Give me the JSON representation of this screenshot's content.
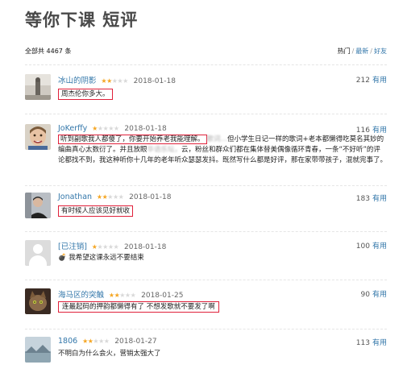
{
  "page": {
    "title": "等你下课 短评"
  },
  "meta": {
    "total": "全部共 4467 条",
    "sort": {
      "hot": "热门",
      "new": "最新",
      "friends": "好友",
      "sep": "/"
    }
  },
  "reviews": [
    {
      "user": "冰山的阴影",
      "stars": 2,
      "date": "2018-01-18",
      "votes": "212",
      "useful": "有用",
      "body": "周杰伦你多大。",
      "avatar_icon": "user-avatar-grey-figure"
    },
    {
      "user": "JoKerffy",
      "stars": 1,
      "date": "2018-01-18",
      "votes": "116",
      "useful": "有用",
      "body_hl": "听到副歌我人都傻了，你要开始养老我能理解。",
      "body_blur1": "歌词…",
      "body_rest1": "但小学生日记一样的歌词+老本都懒得吃莫名其妙的编曲真心太数衍了。并且放眼",
      "body_blur2": "华语乐坛，",
      "body_rest2": "云，粉丝和群众们都在集体替美偶像循环青春，一条“不好听”的评论都找不到，我这种听你十几年的老年听众瑟瑟发抖。既然写什么都是好评，那在家带带孩子，混就完事了。",
      "avatar_icon": "user-avatar-boy-photo"
    },
    {
      "user": "Jonathan",
      "stars": 2,
      "date": "2018-01-18",
      "votes": "183",
      "useful": "有用",
      "body": "有时候人应该见好就收",
      "avatar_icon": "user-avatar-man-photo"
    },
    {
      "user": "[已注销]",
      "stars": 1,
      "date": "2018-01-18",
      "votes": "100",
      "useful": "有用",
      "body": "💣 我希望这课永远不要结束",
      "avatar_icon": "default-avatar-icon"
    },
    {
      "user": "海马区的突触",
      "stars": 2,
      "date": "2018-01-25",
      "votes": "90",
      "useful": "有用",
      "body": "连最起码的押韵都懒得有了 不想发歌就不要发了啊",
      "avatar_icon": "user-avatar-cat-photo"
    },
    {
      "user": "1806",
      "stars": 2,
      "date": "2018-01-27",
      "votes": "113",
      "useful": "有用",
      "body": "不明白为什么会火，营销太强大了",
      "avatar_icon": "user-avatar-landscape-photo"
    }
  ],
  "colors": {
    "link": "#3377aa",
    "star": "#f5a623",
    "highlight": "#e0203a"
  }
}
